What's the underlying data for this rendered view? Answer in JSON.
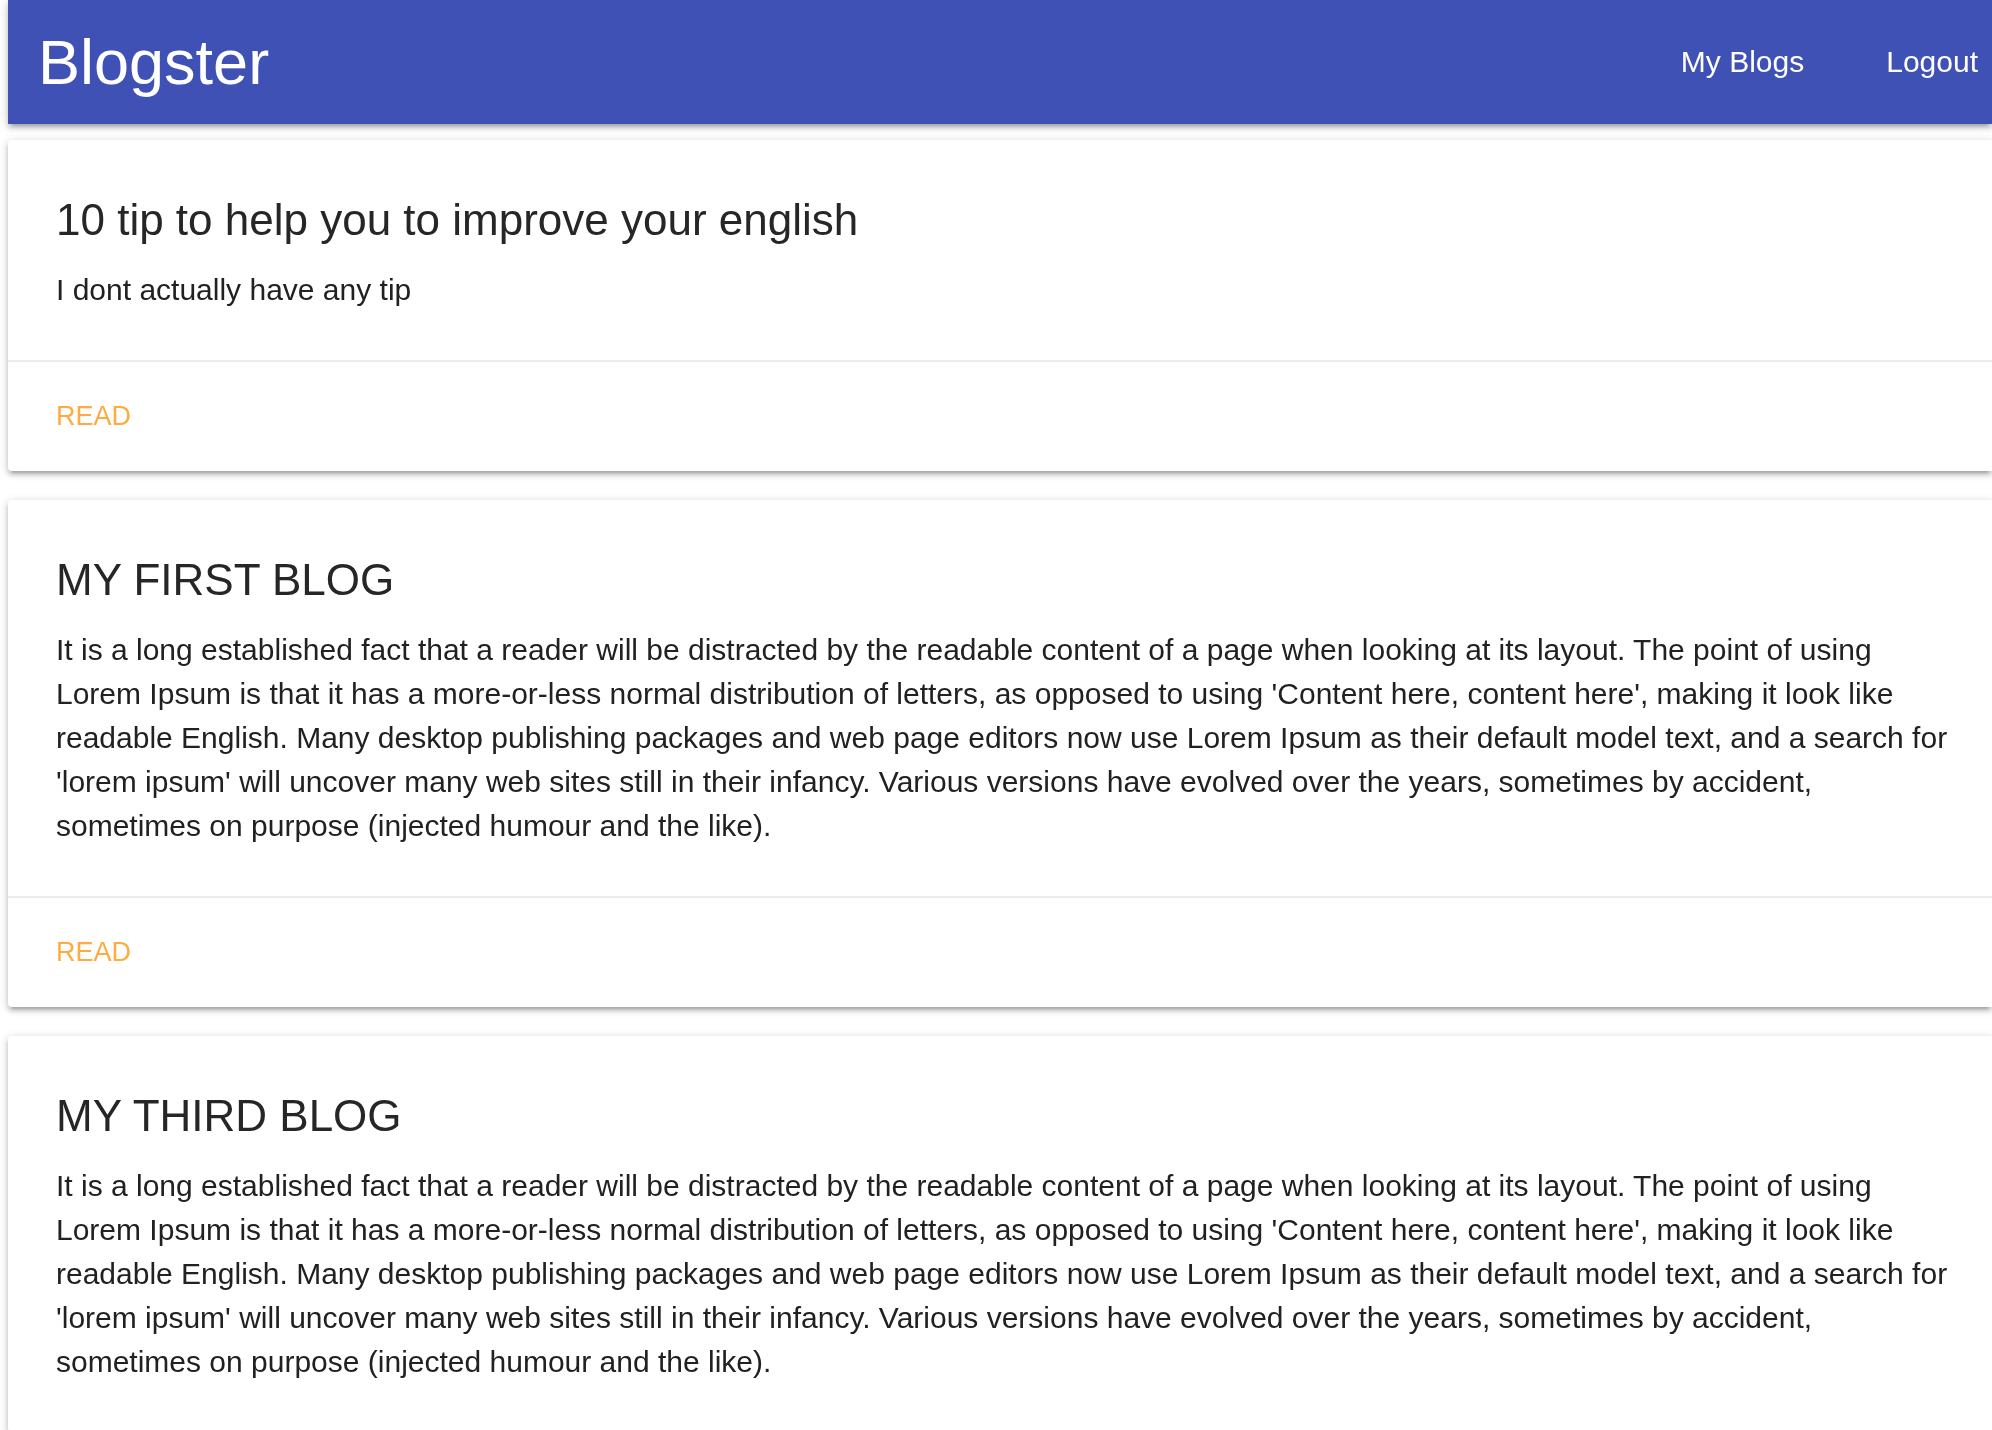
{
  "navbar": {
    "brand": "Blogster",
    "links": [
      {
        "label": "My Blogs"
      },
      {
        "label": "Logout"
      }
    ]
  },
  "posts": [
    {
      "title": "10 tip to help you to improve your english",
      "body": "I dont actually have any tip",
      "action": "READ"
    },
    {
      "title": "MY FIRST BLOG",
      "body": "It is a long established fact that a reader will be distracted by the readable content of a page when looking at its layout. The point of using Lorem Ipsum is that it has a more-or-less normal distribution of letters, as opposed to using 'Content here, content here', making it look like readable English. Many desktop publishing packages and web page editors now use Lorem Ipsum as their default model text, and a search for 'lorem ipsum' will uncover many web sites still in their infancy. Various versions have evolved over the years, sometimes by accident, sometimes on purpose (injected humour and the like).",
      "action": "READ"
    },
    {
      "title": "MY THIRD BLOG",
      "body": "It is a long established fact that a reader will be distracted by the readable content of a page when looking at its layout. The point of using Lorem Ipsum is that it has a more-or-less normal distribution of letters, as opposed to using 'Content here, content here', making it look like readable English. Many desktop publishing packages and web page editors now use Lorem Ipsum as their default model text, and a search for 'lorem ipsum' will uncover many web sites still in their infancy. Various versions have evolved over the years, sometimes by accident, sometimes on purpose (injected humour and the like)."
    }
  ]
}
